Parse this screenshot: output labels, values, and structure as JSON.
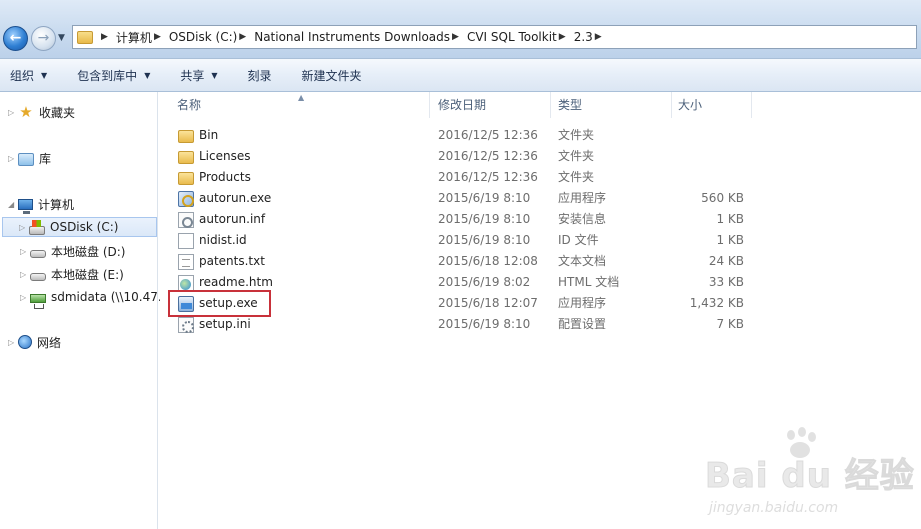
{
  "address_bar": {
    "breadcrumbs": [
      "计算机",
      "OSDisk (C:)",
      "National Instruments Downloads",
      "CVI SQL Toolkit",
      "2.3"
    ]
  },
  "toolbar": {
    "organize": "组织",
    "include_in_library": "包含到库中",
    "share": "共享",
    "burn": "刻录",
    "new_folder": "新建文件夹"
  },
  "nav": {
    "favorites": "收藏夹",
    "libraries": "库",
    "computer": "计算机",
    "drives": [
      {
        "label": "OSDisk (C:)",
        "selected": true
      },
      {
        "label": "本地磁盘 (D:)",
        "selected": false
      },
      {
        "label": "本地磁盘 (E:)",
        "selected": false
      },
      {
        "label": "sdmidata (\\\\10.47.",
        "selected": false
      }
    ],
    "network": "网络"
  },
  "columns": {
    "name": "名称",
    "date": "修改日期",
    "type": "类型",
    "size": "大小"
  },
  "files": [
    {
      "name": "Bin",
      "date": "2016/12/5 12:36",
      "type": "文件夹",
      "size": "",
      "icon": "folder-icon"
    },
    {
      "name": "Licenses",
      "date": "2016/12/5 12:36",
      "type": "文件夹",
      "size": "",
      "icon": "folder-icon"
    },
    {
      "name": "Products",
      "date": "2016/12/5 12:36",
      "type": "文件夹",
      "size": "",
      "icon": "folder-icon"
    },
    {
      "name": "autorun.exe",
      "date": "2015/6/19 8:10",
      "type": "应用程序",
      "size": "560 KB",
      "icon": "exe-icon"
    },
    {
      "name": "autorun.inf",
      "date": "2015/6/19 8:10",
      "type": "安装信息",
      "size": "1 KB",
      "icon": "inf-icon"
    },
    {
      "name": "nidist.id",
      "date": "2015/6/19 8:10",
      "type": "ID 文件",
      "size": "1 KB",
      "icon": "document-icon"
    },
    {
      "name": "patents.txt",
      "date": "2015/6/18 12:08",
      "type": "文本文档",
      "size": "24 KB",
      "icon": "text-file-icon"
    },
    {
      "name": "readme.htm",
      "date": "2015/6/19 8:02",
      "type": "HTML 文档",
      "size": "33 KB",
      "icon": "html-file-icon"
    },
    {
      "name": "setup.exe",
      "date": "2015/6/18 12:07",
      "type": "应用程序",
      "size": "1,432 KB",
      "icon": "setup-exe-icon"
    },
    {
      "name": "setup.ini",
      "date": "2015/6/19 8:10",
      "type": "配置设置",
      "size": "7 KB",
      "icon": "ini-file-icon"
    }
  ],
  "watermark": {
    "logo": "Bai du 经验",
    "url": "jingyan.baidu.com"
  },
  "colors": {
    "highlight_box": "#c8313a",
    "toolbar_text": "#1e3150",
    "selection_border": "#a8c6ee"
  }
}
